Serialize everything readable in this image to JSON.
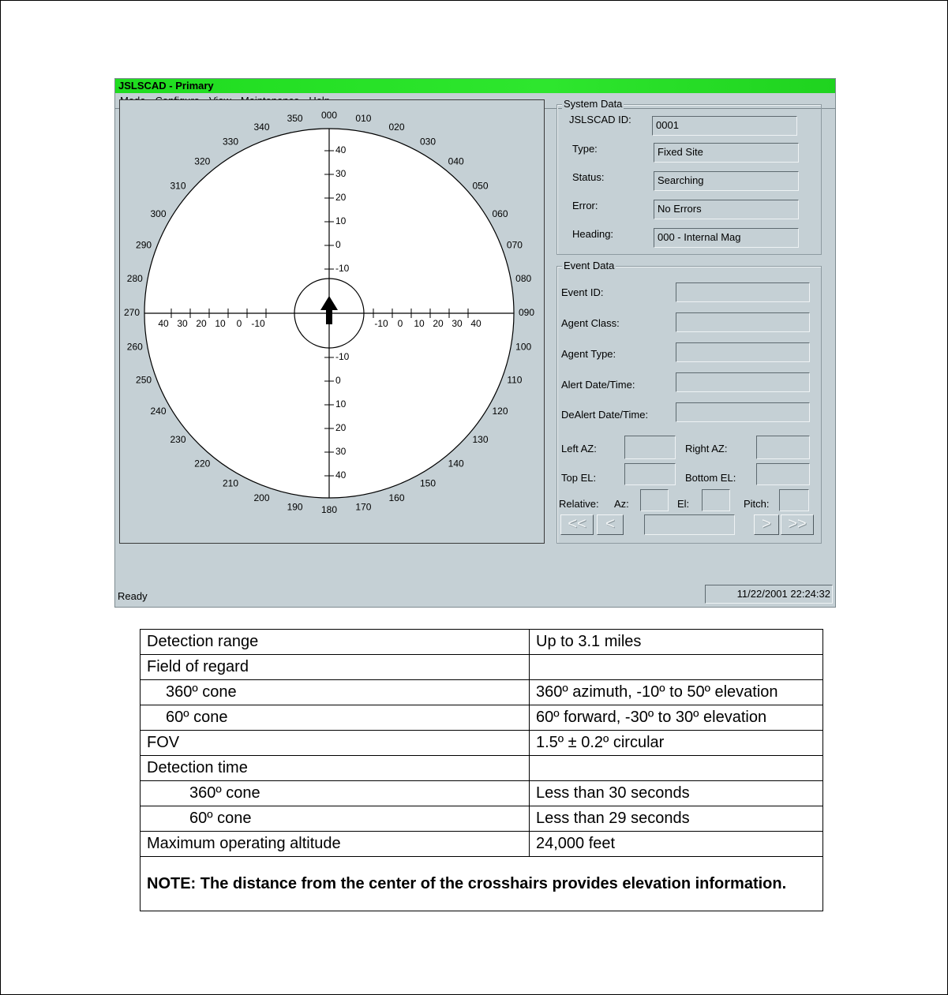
{
  "window": {
    "title": "JSLSCAD - Primary"
  },
  "menu": [
    {
      "label": "Mode"
    },
    {
      "label": "Configure"
    },
    {
      "label": "View"
    },
    {
      "label": "Maintenance"
    },
    {
      "label": "Help"
    }
  ],
  "compass": {
    "bearing_labels": [
      "000",
      "010",
      "020",
      "030",
      "040",
      "050",
      "060",
      "070",
      "080",
      "090",
      "100",
      "110",
      "120",
      "130",
      "140",
      "150",
      "160",
      "170",
      "180",
      "190",
      "200",
      "210",
      "220",
      "230",
      "240",
      "250",
      "260",
      "270",
      "280",
      "290",
      "300",
      "310",
      "320",
      "330",
      "340",
      "350"
    ],
    "vertical_upper_labels": [
      "40",
      "30",
      "20",
      "10",
      "0",
      "-10"
    ],
    "vertical_lower_labels": [
      "-10",
      "0",
      "10",
      "20",
      "30",
      "40"
    ],
    "horizontal_left_labels": [
      "40",
      "30",
      "20",
      "10",
      "0",
      "-10"
    ],
    "horizontal_right_labels": [
      "-10",
      "0",
      "10",
      "20",
      "30",
      "40"
    ],
    "heading_arrow": "up-arrow-icon"
  },
  "system_data": {
    "title": "System Data",
    "fields": [
      {
        "label": "JSLSCAD ID:",
        "value": "0001"
      },
      {
        "label": "Type:",
        "value": "Fixed Site"
      },
      {
        "label": "Status:",
        "value": "Searching"
      },
      {
        "label": "Error:",
        "value": "No Errors"
      },
      {
        "label": "Heading:",
        "value": "000 - Internal Mag"
      }
    ]
  },
  "event_data": {
    "title": "Event Data",
    "fields": [
      {
        "label": "Event ID:",
        "value": ""
      },
      {
        "label": "Agent Class:",
        "value": ""
      },
      {
        "label": "Agent Type:",
        "value": ""
      },
      {
        "label": "Alert Date/Time:",
        "value": ""
      },
      {
        "label": "DeAlert Date/Time:",
        "value": ""
      }
    ],
    "left_az_label": "Left AZ:",
    "right_az_label": "Right AZ:",
    "top_el_label": "Top EL:",
    "bottom_el_label": "Bottom EL:",
    "relative_label": "Relative:",
    "az_label": "Az:",
    "el_label": "El:",
    "pitch_label": "Pitch:",
    "nav": {
      "first": "<<",
      "prev": "<",
      "next": ">",
      "last": ">>"
    }
  },
  "status_bar": {
    "left": "Ready",
    "right": "11/22/2001 22:24:32"
  },
  "spec_table": {
    "rows": [
      {
        "label": "Detection range",
        "value": "Up to 3.1 miles"
      },
      {
        "label": "Field of regard",
        "value": ""
      },
      {
        "label": "360º cone",
        "value": "360º azimuth, -10º to 50º elevation"
      },
      {
        "label": "60º cone",
        "value": "60º forward, -30º to 30º elevation"
      },
      {
        "label": "FOV",
        "value": "1.5º ± 0.2º circular"
      },
      {
        "label": "Detection time",
        "value": ""
      },
      {
        "label": "360º cone",
        "value": "Less than 30 seconds"
      },
      {
        "label": "60º cone",
        "value": "Less than 29 seconds"
      },
      {
        "label": "Maximum operating altitude",
        "value": "24,000 feet"
      }
    ],
    "note": "NOTE: The distance from the center of the crosshairs provides elevation information."
  }
}
